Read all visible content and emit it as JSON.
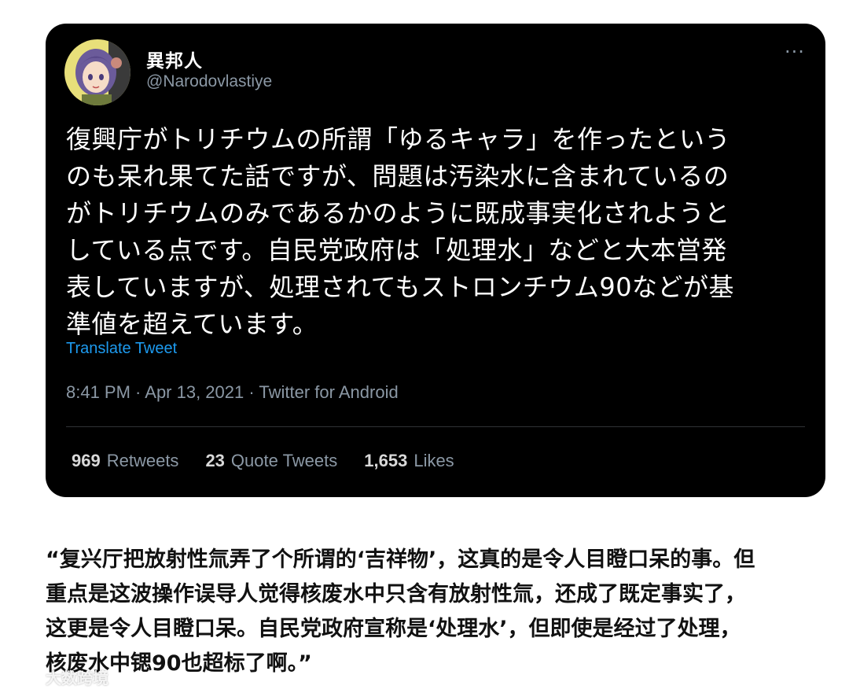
{
  "tweet": {
    "display_name": "異邦人",
    "handle": "@Narodovlastiye",
    "more_icon": "more-horizontal-icon",
    "more_glyph": "···",
    "avatar_icon": "avatar-anime-girl",
    "body": "復興庁がトリチウムの所謂「ゆるキャラ」を作ったという\nのも呆れ果てた話ですが、問題は汚染水に含まれているの\nがトリチウムのみであるかのように既成事実化されようと\nしている点です。自民党政府は「処理水」などと大本営発\n表していますが、処理されてもストロンチウム90などが基\n準値を超えています。",
    "translate_label": "Translate Tweet",
    "timestamp": "8:41 PM · Apr 13, 2021 · Twitter for Android",
    "stats": {
      "retweets_count": "969",
      "retweets_label": "Retweets",
      "quote_count": "23",
      "quote_label": "Quote Tweets",
      "likes_count": "1,653",
      "likes_label": "Likes"
    },
    "colors": {
      "background": "#000000",
      "text": "#ffffff",
      "secondary": "#8b98a5",
      "link": "#1d9bf0"
    }
  },
  "translation": {
    "text": "“复兴厅把放射性氚弄了个所谓的‘吉祥物’，这真的是令人目瞪口呆的事。但\n重点是这波操作误导人觉得核废水中只含有放射性氚，还成了既定事实了，\n这更是令人目瞪口呆。自民党政府宣称是‘处理水’，但即使是经过了处理，\n核废水中锶90也超标了啊。”"
  },
  "watermark": {
    "text": "大数跨境",
    "logo_icon": "watermark-logo"
  }
}
